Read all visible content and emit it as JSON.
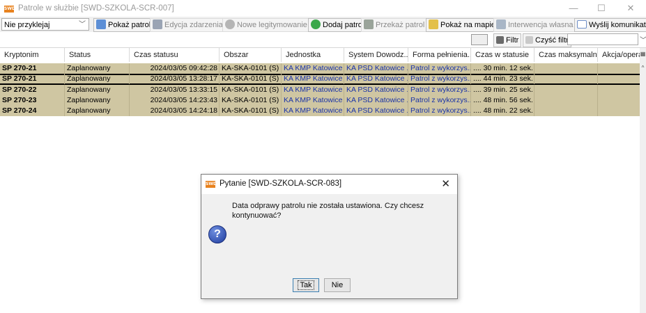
{
  "window": {
    "logo": "SWD",
    "title": "Patrole w służbie [SWD-SZKOLA-SCR-007]",
    "controls": [
      "—",
      "☐",
      "✕"
    ]
  },
  "toolbar": {
    "combo_value": "Nie przyklejaj",
    "buttons": [
      {
        "label": "Pokaż patrol",
        "icon": "show-patrol-icon",
        "enabled": true
      },
      {
        "label": "Edycja zdarzenia",
        "icon": "edit-event-icon",
        "enabled": false
      },
      {
        "label": "Nowe legitymowanie",
        "icon": "new-id-check-icon",
        "enabled": false
      },
      {
        "label": "Dodaj patrol",
        "icon": "add-patrol-icon",
        "enabled": true
      },
      {
        "label": "Przekaż patrol",
        "icon": "transfer-patrol-icon",
        "enabled": false
      },
      {
        "label": "Pokaż na mapie",
        "icon": "map-icon",
        "enabled": true
      },
      {
        "label": "Interwencja własna",
        "icon": "own-intervention-icon",
        "enabled": false
      },
      {
        "label": "Wyślij komunikat",
        "icon": "send-message-icon",
        "enabled": true
      }
    ]
  },
  "filterbar": {
    "filter_label": "Filtr",
    "clear_filter_label": "Czyść filtr",
    "search_value": ""
  },
  "table": {
    "columns": [
      "Kryptonim",
      "Status",
      "Czas statusu",
      "Obszar",
      "Jednostka",
      "System Dowodz...",
      "Forma pełnienia...",
      "Czas w statusie",
      "Czas maksymalny",
      "Akcja/operac"
    ],
    "rows": [
      [
        "SP 270-21",
        "Zaplanowany",
        "2024/03/05 09:42:28",
        "KA-SKA-0101 (S)",
        "KA KMP Katowice",
        "KA PSD Katowice ...",
        "Patrol z wykorzys...",
        ".... 30 min. 12 sek.",
        "",
        ""
      ],
      [
        "SP 270-21",
        "Zaplanowany",
        "2024/03/05 13:28:17",
        "KA-SKA-0101 (S)",
        "KA KMP Katowice",
        "KA PSD Katowice ...",
        "Patrol z wykorzys...",
        ".... 44 min. 23 sek.",
        "",
        ""
      ],
      [
        "SP 270-22",
        "Zaplanowany",
        "2024/03/05 13:33:15",
        "KA-SKA-0101 (S)",
        "KA KMP Katowice",
        "KA PSD Katowice ...",
        "Patrol z wykorzys...",
        ".... 39 min. 25 sek.",
        "",
        ""
      ],
      [
        "SP 270-23",
        "Zaplanowany",
        "2024/03/05 14:23:43",
        "KA-SKA-0101 (S)",
        "KA KMP Katowice",
        "KA PSD Katowice ...",
        "Patrol z wykorzys...",
        ".... 48 min. 56 sek.",
        "",
        ""
      ],
      [
        "SP 270-24",
        "Zaplanowany",
        "2024/03/05 14:24:18",
        "KA-SKA-0101 (S)",
        "KA KMP Katowice",
        "KA PSD Katowice ...",
        "Patrol z wykorzys...",
        ".... 48 min. 22 sek.",
        "",
        ""
      ]
    ]
  },
  "dialog": {
    "logo": "SWD",
    "title": "Pytanie [SWD-SZKOLA-SCR-083]",
    "close": "✕",
    "message": "Data odprawy patrolu nie została ustawiona. Czy chcesz kontynuować?",
    "icon_glyph": "?",
    "yes_label": "Tak",
    "no_label": "Nie"
  },
  "colors": {
    "row_bg": "#cfc6a2",
    "selected_row_border": "#000000",
    "link_text": "#1a33a8"
  }
}
